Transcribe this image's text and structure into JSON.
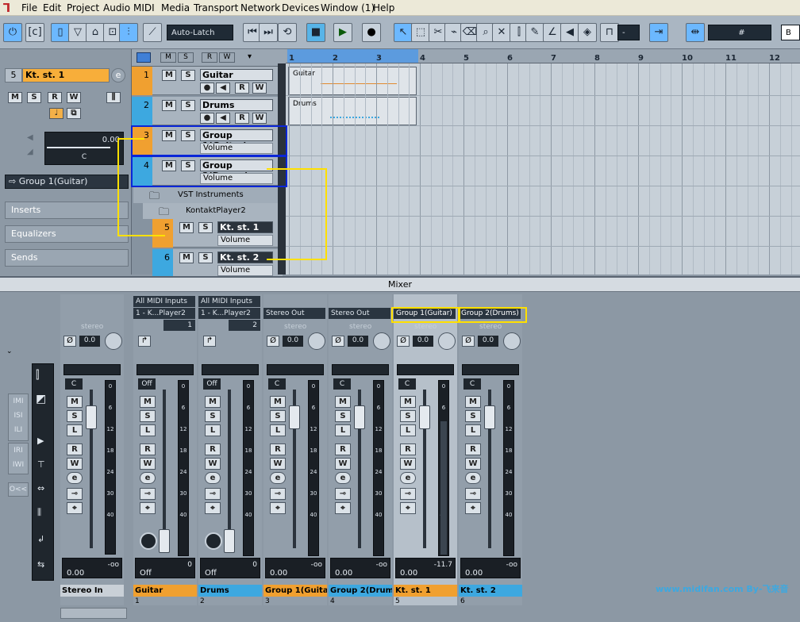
{
  "menubar": {
    "items": [
      "File",
      "Edit",
      "Project",
      "Audio",
      "MIDI",
      "Media",
      "Transport",
      "Network",
      "Devices",
      "Window (1)",
      "Help"
    ]
  },
  "toolbar": {
    "automation_mode": "Auto-Latch",
    "quantize": "-",
    "edge_label": "B"
  },
  "ruler": {
    "bars": [
      "1",
      "2",
      "3",
      "4",
      "5",
      "6",
      "7",
      "8",
      "9",
      "10",
      "11",
      "12"
    ]
  },
  "inspector": {
    "track_number": "5",
    "track_name": "Kt. st. 1",
    "volume_value": "0.00",
    "pan_value": "C",
    "output_routing": "Group 1(Guitar)",
    "sections": [
      "Inserts",
      "Equalizers",
      "Sends"
    ]
  },
  "tracks": [
    {
      "num": "1",
      "name": "Guitar",
      "color": "#f0a030",
      "sub": ""
    },
    {
      "num": "2",
      "name": "Drums",
      "color": "#3da8e0",
      "sub": ""
    },
    {
      "num": "3",
      "name": "Group 1(Guitar)",
      "color": "#f0a030",
      "sub": "Volume"
    },
    {
      "num": "4",
      "name": "Group 2(Drums)",
      "color": "#3da8e0",
      "sub": "Volume"
    }
  ],
  "folders": {
    "vst": "VST Instruments",
    "kontakt": "KontaktPlayer2"
  },
  "inst_tracks": [
    {
      "num": "5",
      "name": "Kt. st. 1",
      "color": "#f0a030",
      "sub": "Volume"
    },
    {
      "num": "6",
      "name": "Kt. st. 2",
      "color": "#3da8e0",
      "sub": "Volume"
    }
  ],
  "parts": [
    {
      "label": "Guitar"
    },
    {
      "label": "Drums"
    }
  ],
  "mixer": {
    "title": "Mixer",
    "footer_credit": "www.midifan.com By-飞来音",
    "channels": [
      {
        "name": "Stereo In",
        "num": "",
        "color": "#c9d0d7",
        "in": "",
        "out": "",
        "pan": "C",
        "vol": "0.00",
        "peak": "-oo",
        "setting": "stereo",
        "phase": "Ø",
        "gain": "0.0"
      },
      {
        "name": "Guitar",
        "num": "1",
        "color": "#f0a030",
        "in": "All MIDI Inputs",
        "out": "1 - K...Player2",
        "ch": "1",
        "pan": "Off",
        "vol": "Off",
        "peak": "0",
        "setting": "",
        "phase": "",
        "gain": ""
      },
      {
        "name": "Drums",
        "num": "2",
        "color": "#3da8e0",
        "in": "All MIDI Inputs",
        "out": "1 - K...Player2",
        "ch": "2",
        "pan": "Off",
        "vol": "Off",
        "peak": "0",
        "setting": "",
        "phase": "",
        "gain": ""
      },
      {
        "name": "Group 1(Guitar",
        "num": "3",
        "color": "#f0a030",
        "in": "",
        "out": "Stereo Out",
        "pan": "C",
        "vol": "0.00",
        "peak": "-oo",
        "setting": "stereo",
        "phase": "Ø",
        "gain": "0.0"
      },
      {
        "name": "Group 2(Drum",
        "num": "4",
        "color": "#3da8e0",
        "in": "",
        "out": "Stereo Out",
        "pan": "C",
        "vol": "0.00",
        "peak": "-oo",
        "setting": "stereo",
        "phase": "Ø",
        "gain": "0.0"
      },
      {
        "name": "Kt. st. 1",
        "num": "5",
        "color": "#f0a030",
        "in": "",
        "out": "Group 1(Guitar)",
        "pan": "C",
        "vol": "0.00",
        "peak": "-11.7",
        "setting": "stereo",
        "phase": "Ø",
        "gain": "0.0"
      },
      {
        "name": "Kt. st. 2",
        "num": "6",
        "color": "#3da8e0",
        "in": "",
        "out": "Group 2(Drums)",
        "pan": "C",
        "vol": "0.00",
        "peak": "-oo",
        "setting": "stereo",
        "phase": "Ø",
        "gain": "0.0"
      }
    ],
    "meter_scale": [
      "0",
      "6",
      "12",
      "18",
      "24",
      "30",
      "40"
    ],
    "side_labels": [
      "IMI",
      "ISI",
      "ILI",
      "IRI",
      "IWI",
      "O<<"
    ]
  }
}
